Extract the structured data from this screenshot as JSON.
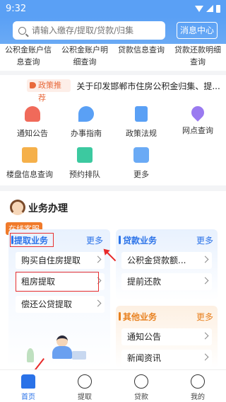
{
  "status_bar": {
    "time": "9:32"
  },
  "header": {
    "search_placeholder": "请输入缴存/提取/贷款/归集",
    "message_button": "消息中心"
  },
  "top_row": [
    {
      "line1": "公积金账户信",
      "line2": "息查询"
    },
    {
      "line1": "公积金账户明",
      "line2": "细查询"
    },
    {
      "line1": "贷款信息查询",
      "line2": ""
    },
    {
      "line1": "贷款还款明细",
      "line2": "查询"
    }
  ],
  "notice": {
    "tag": "政策推荐",
    "text": "关于印发邯郸市住房公积金归集、提..."
  },
  "quick_grid": [
    {
      "label": "通知公告",
      "icon": "bell-icon"
    },
    {
      "label": "办事指南",
      "icon": "guide-icon"
    },
    {
      "label": "政策法规",
      "icon": "document-icon"
    },
    {
      "label": "网点查询",
      "icon": "location-pin-icon"
    },
    {
      "label": "楼盘信息查询",
      "icon": "building-icon"
    },
    {
      "label": "预约排队",
      "icon": "calendar-icon"
    },
    {
      "label": "更多",
      "icon": "more-icon"
    }
  ],
  "business": {
    "title": "业务办理",
    "online_service": "在线客服",
    "withdrawal": {
      "title": "提取业务",
      "more": "更多",
      "items": [
        "购买自住房提取",
        "租房提取",
        "偿还公贷提取"
      ]
    },
    "loan": {
      "title": "贷款业务",
      "more": "更多",
      "items": [
        "公积金贷款额...",
        "提前还款"
      ]
    },
    "other": {
      "title": "其他业务",
      "more": "更多",
      "items": [
        "通知公告",
        "新闻资讯"
      ]
    }
  },
  "bottom_nav": [
    {
      "label": "首页",
      "active": true
    },
    {
      "label": "提取",
      "active": false
    },
    {
      "label": "贷款",
      "active": false
    },
    {
      "label": "我的",
      "active": false
    }
  ],
  "colors": {
    "primary": "#5aa0f5",
    "accent_blue": "#2a72e8",
    "accent_orange": "#e8801e",
    "annotation_red": "#e83030"
  }
}
